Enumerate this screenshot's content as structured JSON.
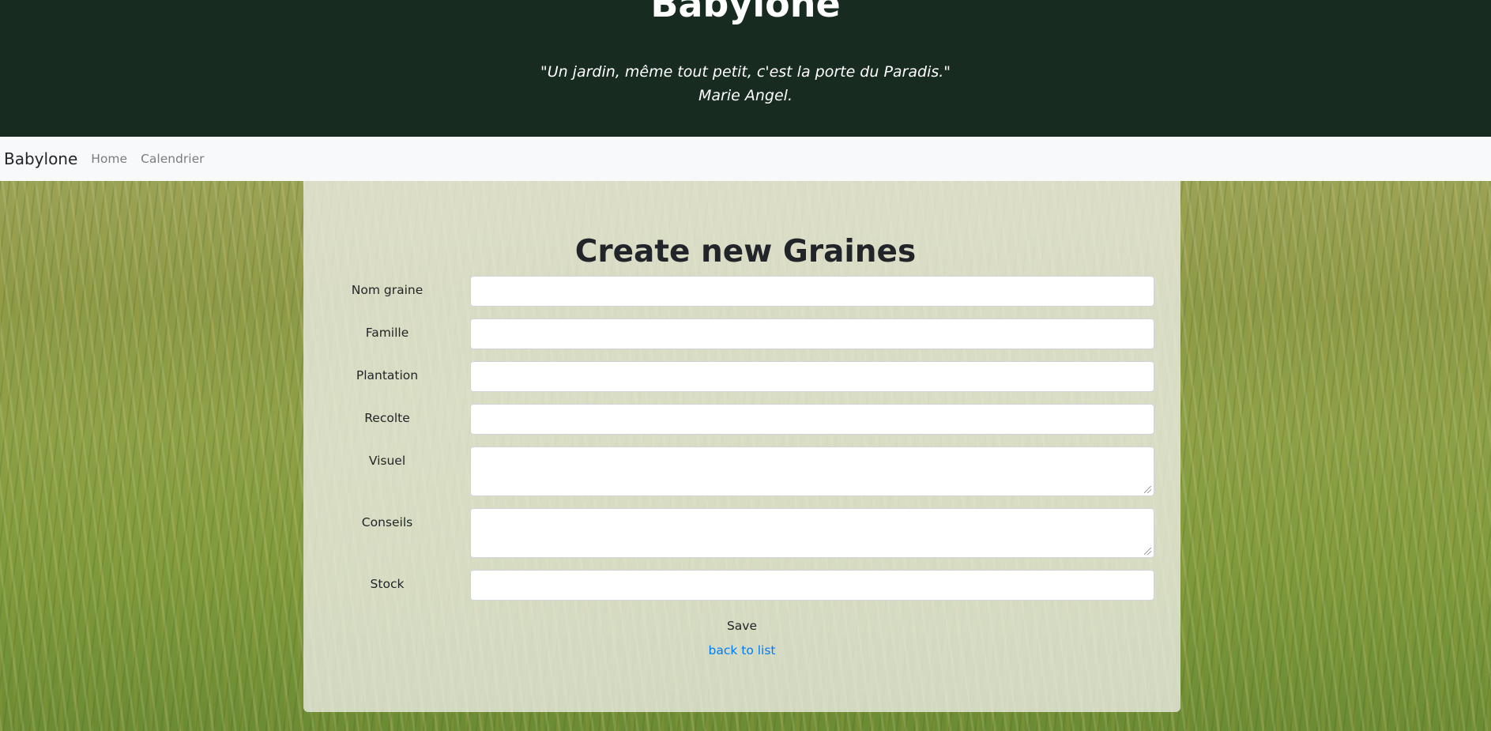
{
  "header": {
    "title": "Babylone",
    "quote": "\"Un jardin, même tout petit, c'est la porte du Paradis.\"",
    "author": "Marie Angel."
  },
  "navbar": {
    "brand": "Babylone",
    "links": [
      "Home",
      "Calendrier"
    ]
  },
  "form": {
    "title": "Create new Graines",
    "fields": [
      {
        "label": "Nom graine",
        "value": "",
        "type": "input"
      },
      {
        "label": "Famille",
        "value": "",
        "type": "input"
      },
      {
        "label": "Plantation",
        "value": "",
        "type": "input"
      },
      {
        "label": "Recolte",
        "value": "",
        "type": "input"
      },
      {
        "label": "Visuel",
        "value": "",
        "type": "textarea"
      },
      {
        "label": "Conseils",
        "value": "",
        "type": "textarea"
      },
      {
        "label": "Stock",
        "value": "",
        "type": "input"
      }
    ],
    "save_label": "Save",
    "back_label": "back to list"
  },
  "colors": {
    "banner_bg": "#172b20",
    "navbar_bg": "#f8f9fa",
    "link": "#007bff"
  }
}
